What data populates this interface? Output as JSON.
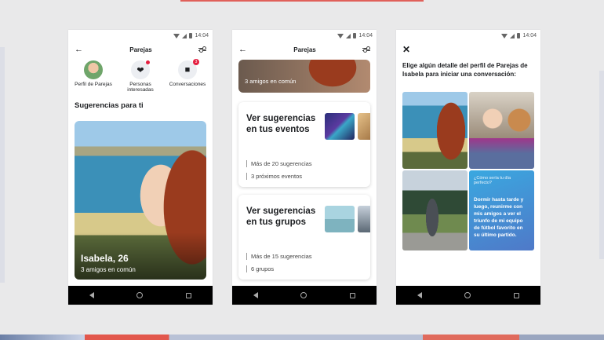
{
  "status_time": "14:04",
  "phone1": {
    "title": "Parejas",
    "shortcuts": [
      {
        "label": "Perfil de Parejas",
        "icon": "avatar-icon"
      },
      {
        "label": "Personas interesadas",
        "icon": "heart-icon"
      },
      {
        "label": "Conversaciones",
        "icon": "chat-icon",
        "badge": "3"
      }
    ],
    "section_heading": "Sugerencias para ti",
    "card": {
      "name": "Isabela, 26",
      "mutual": "3 amigos en común"
    }
  },
  "phone2": {
    "title": "Parejas",
    "top_card_sub": "3 amigos en común",
    "events": {
      "title": "Ver sugerencias en tus eventos",
      "line1": "Más de 20 sugerencias",
      "line2": "3 próximos eventos"
    },
    "groups": {
      "title": "Ver sugerencias en tus grupos",
      "line1": "Más de 15 sugerencias",
      "line2": "6 grupos"
    }
  },
  "phone3": {
    "prompt": "Elige algún detalle del perfil de Parejas de Isabela para iniciar una conversación:",
    "question": "¿Cómo sería tu día perfecto?",
    "answer": "Dormir hasta tarde y luego, reunirme con mis amigos a ver el triunfo de mi equipo de fútbol favorito en su último partido."
  },
  "colors": {
    "accent_red": "#e41e3f",
    "card_blue": "#3aa8e0",
    "background": "#e9e9ea"
  }
}
